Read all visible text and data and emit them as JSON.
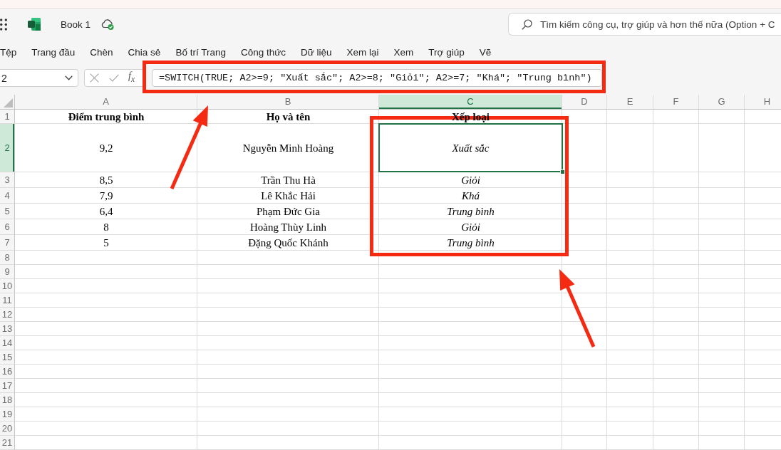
{
  "title_bar": {
    "document_title": "Book 1",
    "search": {
      "placeholder": "Tìm kiếm công cụ, trợ giúp và hơn thế nữa (Option + C"
    }
  },
  "ribbon_tabs": [
    "Tệp",
    "Trang đầu",
    "Chèn",
    "Chia sẻ",
    "Bố trí Trang",
    "Công thức",
    "Dữ liệu",
    "Xem lại",
    "Xem",
    "Trợ giúp",
    "Vẽ"
  ],
  "formula_bar": {
    "name_box": "2",
    "function_button": "f$_{x}$",
    "formula": "=SWITCH(TRUE; A2>=9; \"Xuất sắc\"; A2>=8; \"Giỏi\"; A2>=7; \"Khá\"; \"Trung bình\")"
  },
  "sheet": {
    "columns": [
      {
        "label": "A",
        "selected": false
      },
      {
        "label": "B",
        "selected": false
      },
      {
        "label": "C",
        "selected": true
      },
      {
        "label": "D",
        "selected": false
      },
      {
        "label": "E",
        "selected": false
      },
      {
        "label": "F",
        "selected": false
      },
      {
        "label": "G",
        "selected": false
      },
      {
        "label": "H",
        "selected": false
      }
    ],
    "rows": [
      {
        "number": "1",
        "selected": false,
        "kind": "header",
        "cells": [
          {
            "text": "Điểm trung bình",
            "italic": false,
            "selected": false
          },
          {
            "text": "Họ và tên",
            "italic": false,
            "selected": false
          },
          {
            "text": "Xếp loại",
            "italic": false,
            "selected": false
          }
        ]
      },
      {
        "number": "2",
        "selected": true,
        "kind": "data",
        "cells": [
          {
            "text": "9,2",
            "italic": false,
            "selected": false
          },
          {
            "text": "Nguyễn Minh Hoàng",
            "italic": false,
            "selected": false
          },
          {
            "text": "Xuất sắc",
            "italic": true,
            "selected": true
          }
        ]
      },
      {
        "number": "3",
        "selected": false,
        "kind": "data",
        "cells": [
          {
            "text": "8,5",
            "italic": false,
            "selected": false
          },
          {
            "text": "Trần Thu Hà",
            "italic": false,
            "selected": false
          },
          {
            "text": "Giỏi",
            "italic": true,
            "selected": false
          }
        ]
      },
      {
        "number": "4",
        "selected": false,
        "kind": "data",
        "cells": [
          {
            "text": "7,9",
            "italic": false,
            "selected": false
          },
          {
            "text": "Lê Khắc Hải",
            "italic": false,
            "selected": false
          },
          {
            "text": "Khá",
            "italic": true,
            "selected": false
          }
        ]
      },
      {
        "number": "5",
        "selected": false,
        "kind": "data",
        "cells": [
          {
            "text": "6,4",
            "italic": false,
            "selected": false
          },
          {
            "text": "Phạm Đức Gia",
            "italic": false,
            "selected": false
          },
          {
            "text": "Trung bình",
            "italic": true,
            "selected": false
          }
        ]
      },
      {
        "number": "6",
        "selected": false,
        "kind": "data",
        "cells": [
          {
            "text": "8",
            "italic": false,
            "selected": false
          },
          {
            "text": "Hoàng Thùy Linh",
            "italic": false,
            "selected": false
          },
          {
            "text": "Giỏi",
            "italic": true,
            "selected": false
          }
        ]
      },
      {
        "number": "7",
        "selected": false,
        "kind": "data",
        "cells": [
          {
            "text": "5",
            "italic": false,
            "selected": false
          },
          {
            "text": "Đặng Quốc Khánh",
            "italic": false,
            "selected": false
          },
          {
            "text": "Trung bình",
            "italic": true,
            "selected": false
          }
        ]
      },
      {
        "number": "8",
        "selected": false
      },
      {
        "number": "9",
        "selected": false
      },
      {
        "number": "10",
        "selected": false
      },
      {
        "number": "11",
        "selected": false
      },
      {
        "number": "12",
        "selected": false
      },
      {
        "number": "13",
        "selected": false
      },
      {
        "number": "14",
        "selected": false
      },
      {
        "number": "15",
        "selected": false
      },
      {
        "number": "16",
        "selected": false
      },
      {
        "number": "17",
        "selected": false
      },
      {
        "number": "18",
        "selected": false
      },
      {
        "number": "19",
        "selected": false
      },
      {
        "number": "20",
        "selected": false
      },
      {
        "number": "21",
        "selected": false
      }
    ]
  }
}
